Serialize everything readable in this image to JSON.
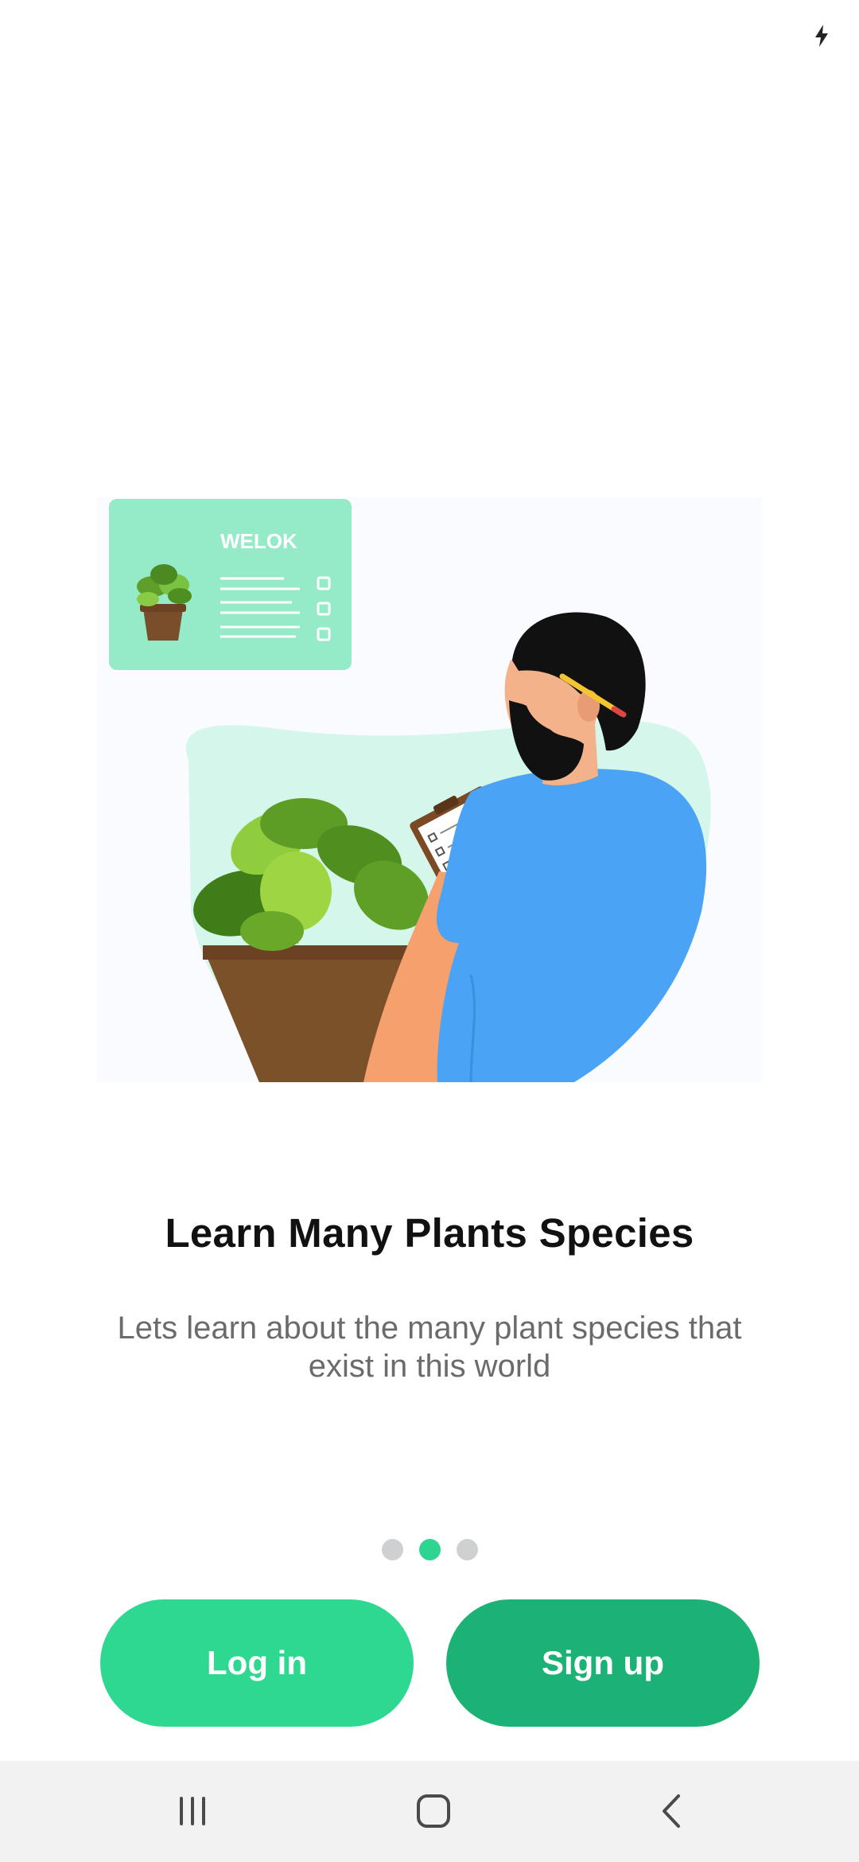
{
  "status_bar": {
    "icons": [
      "charging-icon"
    ]
  },
  "illustration": {
    "card_label": "WELOK",
    "description_icons": [
      "potted-plant-icon",
      "person-with-clipboard-illustration"
    ]
  },
  "onboarding": {
    "title": "Learn Many Plants Species",
    "subtitle": "Lets learn about the many plant species that exist in this world",
    "page_indicator": {
      "total": 3,
      "current": 2
    }
  },
  "actions": {
    "login_label": "Log in",
    "signup_label": "Sign up"
  },
  "nav_bar": {
    "icons": [
      "recents-icon",
      "home-icon",
      "back-icon"
    ]
  },
  "colors": {
    "primary": "#2ed891",
    "primary_dark": "#1db275",
    "dot_inactive": "#cfd0d2",
    "shirt": "#4aa3f5",
    "card_bg": "#95ebc8"
  }
}
